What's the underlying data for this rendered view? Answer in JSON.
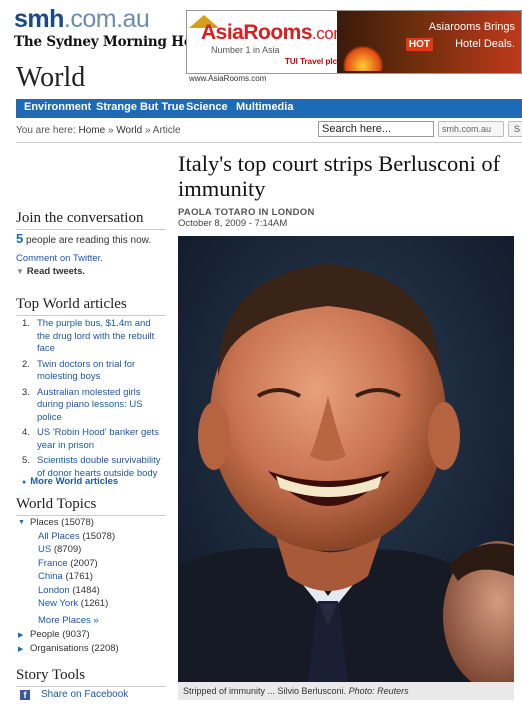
{
  "masthead": {
    "site_a": "smh",
    "site_b": ".com.au",
    "paper": "The Sydney Morning Herald"
  },
  "section_title": "World",
  "ad": {
    "brand": "AsiaRooms",
    "brand_suffix": ".com",
    "tagline": "Number 1 in Asia",
    "partner": "TUI Travel plc",
    "line1": "Asiarooms Brings",
    "hot": "HOT",
    "line2": "Hotel Deals.",
    "url": "www.AsiaRooms.com"
  },
  "nav": {
    "items": [
      "Environment",
      "Strange But True",
      "Science",
      "Multimedia"
    ]
  },
  "breadcrumb": {
    "prefix": "You are here:",
    "home": "Home",
    "sep": "»",
    "world": "World",
    "article": "Article"
  },
  "search": {
    "value": "Search here...",
    "scope": "smh.com.au",
    "button": "S"
  },
  "article": {
    "headline": "Italy's top court strips Berlusconi of immunity",
    "byline": "PAOLA TOTARO IN LONDON",
    "date": "October 8, 2009 - 7:14AM",
    "caption": "Stripped of immunity ... Silvio Berlusconi.",
    "caption_credit": "Photo: Reuters"
  },
  "sidebar": {
    "conversation": {
      "heading": "Join the conversation",
      "count": "5",
      "count_text": "people are reading this now.",
      "twitter": "Comment on Twitter.",
      "read": "Read tweets."
    },
    "top_world": {
      "heading": "Top World articles",
      "items": [
        {
          "num": "1.",
          "text": "The purple bus, $1.4m and the drug lord with the rebuilt face"
        },
        {
          "num": "2.",
          "text": "Twin doctors on trial for molesting boys"
        },
        {
          "num": "3.",
          "text": "Australian molested girls during piano lessons: US police"
        },
        {
          "num": "4.",
          "text": "US 'Robin Hood' banker gets year in prison"
        },
        {
          "num": "5.",
          "text": "Scientists double survivability of donor hearts outside body"
        }
      ],
      "more": "More World articles"
    },
    "topics": {
      "heading": "World Topics",
      "places": "Places (15078)",
      "place_items": [
        {
          "name": "All Places",
          "count": "(15078)"
        },
        {
          "name": "US",
          "count": "(8709)"
        },
        {
          "name": "France",
          "count": "(2007)"
        },
        {
          "name": "China",
          "count": "(1761)"
        },
        {
          "name": "London",
          "count": "(1484)"
        },
        {
          "name": "New York",
          "count": "(1261)"
        }
      ],
      "more_places": "More Places »",
      "people": "People (9037)",
      "organisations": "Organisations (2208)"
    },
    "story_tools": {
      "heading": "Story Tools",
      "facebook": "Share on Facebook"
    }
  },
  "colors": {
    "nav_blue": "#1d6bb7",
    "link_blue": "#1d5aa6",
    "brand_red": "#d81e1e"
  }
}
